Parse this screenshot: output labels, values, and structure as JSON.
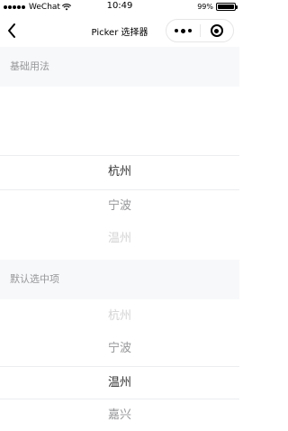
{
  "status_bar": {
    "carrier": "WeChat",
    "time": "10:49",
    "battery_text": "99%",
    "battery_level": 0.99
  },
  "nav": {
    "title": "Picker 选择器",
    "back_icon": "chevron-left-icon",
    "more_icon": "more-dots-icon",
    "close_icon": "target-close-icon"
  },
  "sections": [
    {
      "title": "基础用法",
      "items": [
        "杭州",
        "宁波",
        "温州"
      ]
    },
    {
      "title": "默认选中项",
      "items": [
        "杭州",
        "宁波",
        "温州",
        "嘉兴"
      ]
    }
  ],
  "colors": {
    "section_bg": "#f7f8fa",
    "section_text": "#969799",
    "active_text": "#323233",
    "inactive_text": "#969799",
    "faint_text": "#d4d4d4",
    "divider": "#ebedf0"
  }
}
